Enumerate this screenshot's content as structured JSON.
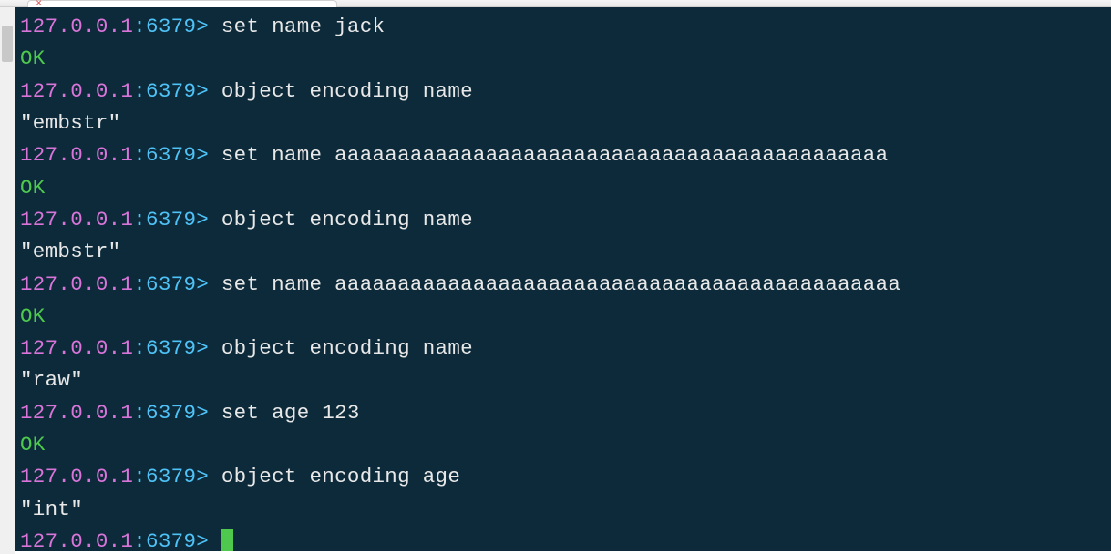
{
  "tab_bar": {
    "close_glyph": "×"
  },
  "prompt": {
    "ip": "127.0.0.1",
    "sep": ":",
    "port": "6379> "
  },
  "lines": [
    {
      "type": "cmd",
      "text": "set name jack"
    },
    {
      "type": "ok",
      "text": "OK"
    },
    {
      "type": "cmd",
      "text": "object encoding name"
    },
    {
      "type": "result",
      "text": "\"embstr\""
    },
    {
      "type": "cmd",
      "text": "set name aaaaaaaaaaaaaaaaaaaaaaaaaaaaaaaaaaaaaaaaaaaa"
    },
    {
      "type": "ok",
      "text": "OK"
    },
    {
      "type": "cmd",
      "text": "object encoding name"
    },
    {
      "type": "result",
      "text": "\"embstr\""
    },
    {
      "type": "cmd",
      "text": "set name aaaaaaaaaaaaaaaaaaaaaaaaaaaaaaaaaaaaaaaaaaaaa"
    },
    {
      "type": "ok",
      "text": "OK"
    },
    {
      "type": "cmd",
      "text": "object encoding name"
    },
    {
      "type": "result",
      "text": "\"raw\""
    },
    {
      "type": "cmd",
      "text": "set age 123"
    },
    {
      "type": "ok",
      "text": "OK"
    },
    {
      "type": "cmd",
      "text": "object encoding age"
    },
    {
      "type": "result",
      "text": "\"int\""
    },
    {
      "type": "prompt-only"
    }
  ]
}
